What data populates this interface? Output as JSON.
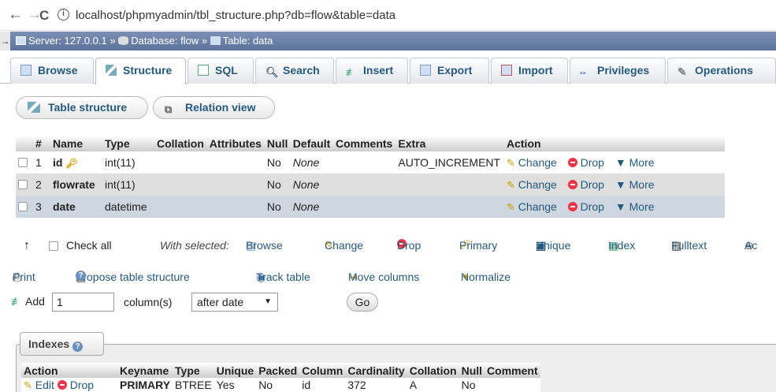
{
  "browser": {
    "url": "localhost/phpmyadmin/tbl_structure.php?db=flow&table=data",
    "back": "←",
    "forward": "→",
    "reload": "C",
    "info": "i"
  },
  "breadcrumb": {
    "server_label": "Server: 127.0.0.1",
    "database_label": "Database: flow",
    "table_label": "Table: data",
    "sep": "»"
  },
  "tabs": [
    {
      "label": "Browse",
      "icon": "browse-icon"
    },
    {
      "label": "Structure",
      "icon": "structure-icon",
      "active": true
    },
    {
      "label": "SQL",
      "icon": "sql-icon"
    },
    {
      "label": "Search",
      "icon": "search-icon"
    },
    {
      "label": "Insert",
      "icon": "insert-icon"
    },
    {
      "label": "Export",
      "icon": "export-icon"
    },
    {
      "label": "Import",
      "icon": "import-icon"
    },
    {
      "label": "Privileges",
      "icon": "privileges-icon"
    },
    {
      "label": "Operations",
      "icon": "operations-icon"
    }
  ],
  "subtabs": {
    "table_structure": "Table structure",
    "relation_view": "Relation view"
  },
  "structure": {
    "headers": [
      "#",
      "Name",
      "Type",
      "Collation",
      "Attributes",
      "Null",
      "Default",
      "Comments",
      "Extra",
      "Action"
    ],
    "rows": [
      {
        "num": "1",
        "name": "id",
        "type": "int(11)",
        "collation": "",
        "attributes": "",
        "null": "No",
        "default": "None",
        "comments": "",
        "extra": "AUTO_INCREMENT",
        "primary": true
      },
      {
        "num": "2",
        "name": "flowrate",
        "type": "int(11)",
        "collation": "",
        "attributes": "",
        "null": "No",
        "default": "None",
        "comments": "",
        "extra": ""
      },
      {
        "num": "3",
        "name": "date",
        "type": "datetime",
        "collation": "",
        "attributes": "",
        "null": "No",
        "default": "None",
        "comments": "",
        "extra": ""
      }
    ],
    "row_actions": {
      "change": "Change",
      "drop": "Drop",
      "more": "More"
    }
  },
  "with_selected": {
    "check_all": "Check all",
    "label": "With selected:",
    "browse": "Browse",
    "change": "Change",
    "drop": "Drop",
    "primary": "Primary",
    "unique": "Unique",
    "index": "Index",
    "fulltext": "Fulltext",
    "add_cut": "Ac"
  },
  "tools": {
    "print": "Print",
    "propose": "Propose table structure",
    "track": "Track table",
    "move": "Move columns",
    "normalize": "Normalize"
  },
  "add_columns": {
    "add_label": "Add",
    "count": "1",
    "columns_label": "column(s)",
    "position": "after date",
    "go": "Go"
  },
  "indexes": {
    "legend": "Indexes",
    "headers": [
      "Action",
      "Keyname",
      "Type",
      "Unique",
      "Packed",
      "Column",
      "Cardinality",
      "Collation",
      "Null",
      "Comment"
    ],
    "row": {
      "edit": "Edit",
      "drop": "Drop",
      "keyname": "PRIMARY",
      "type": "BTREE",
      "unique": "Yes",
      "packed": "No",
      "column": "id",
      "cardinality": "372",
      "collation": "A",
      "null": "No",
      "comment": ""
    }
  }
}
